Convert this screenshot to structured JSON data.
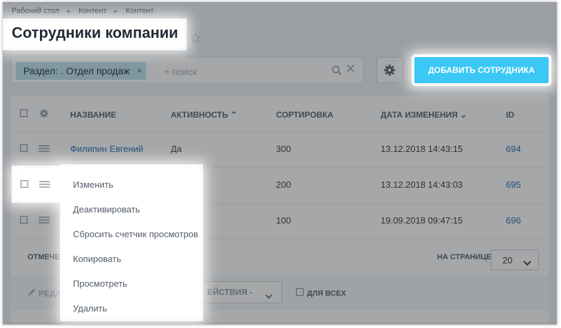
{
  "breadcrumb": [
    "Рабочий стол",
    "Контент",
    "Контент"
  ],
  "page_title": "Сотрудники компании",
  "filter": {
    "tag_label": "Раздел: . Отдел продаж",
    "tag_close": "×",
    "search_placeholder": "+ поиск",
    "clear_glyph": "✕"
  },
  "add_button_label": "Добавить сотрудника",
  "table": {
    "columns": [
      "Название",
      "Активность",
      "Сортировка",
      "Дата изменения",
      "ID"
    ],
    "rows": [
      {
        "name": "Филипин Евгений",
        "active": "Да",
        "sort": "300",
        "date": "13.12.2018 14:43:15",
        "id": "694"
      },
      {
        "name": "",
        "active": "",
        "sort": "200",
        "date": "13.12.2018 14:43:03",
        "id": "695"
      },
      {
        "name": "",
        "active": "",
        "sort": "100",
        "date": "19.09.2018 09:47:15",
        "id": "696"
      }
    ]
  },
  "footer": {
    "selected_label": "Отмечен",
    "per_page_label": "На странице:",
    "per_page_value": "20",
    "edit_label": "Реда",
    "actions_label": "ействия -",
    "for_all_label": "Для всех"
  },
  "context_menu": [
    "Изменить",
    "Деактивировать",
    "Сбросить счетчик просмотров",
    "Копировать",
    "Просмотреть",
    "Удалить"
  ]
}
